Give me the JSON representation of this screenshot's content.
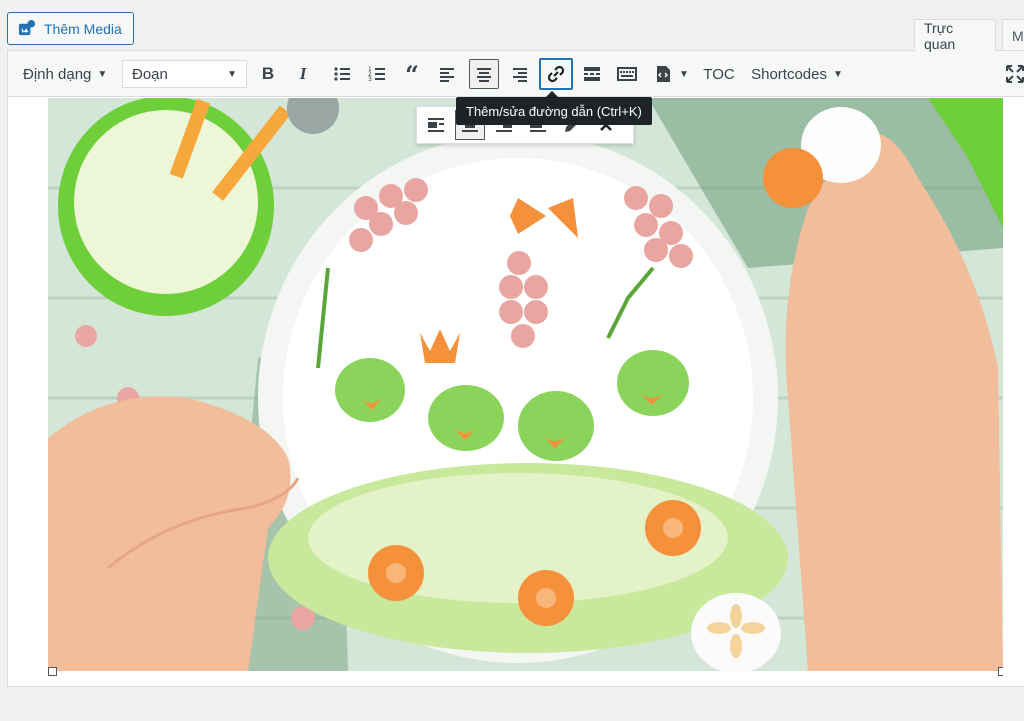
{
  "add_media": {
    "label": "Thêm Media",
    "icon": "media-icon"
  },
  "tabs": [
    {
      "label": "Trực quan",
      "active": true
    },
    {
      "label": "M",
      "active": false
    }
  ],
  "toolbar": {
    "format_label": "Định dạng",
    "paragraph_select": "Đoạn",
    "toc_label": "TOC",
    "shortcodes_label": "Shortcodes",
    "buttons": [
      "bold-icon",
      "italic-icon",
      "bullet-list-icon",
      "numbered-list-icon",
      "blockquote-icon",
      "align-left-icon",
      "align-center-icon",
      "align-right-icon",
      "link-icon",
      "read-more-icon",
      "toolbar-toggle-icon",
      "code-block-icon",
      "fullscreen-icon"
    ]
  },
  "tooltip": {
    "text": "Thêm/sửa đường dẫn (Ctrl+K)"
  },
  "image_toolbar": {
    "buttons": [
      "align-left-icon",
      "align-center-icon",
      "align-right-icon",
      "no-align-icon",
      "edit-icon",
      "remove-icon"
    ],
    "active": "align-center-icon"
  },
  "colors": {
    "accent": "#2271b1",
    "tooltip_bg": "#1d2327",
    "toolbar_bg": "#f6f7f7",
    "border": "#dcdcde"
  }
}
